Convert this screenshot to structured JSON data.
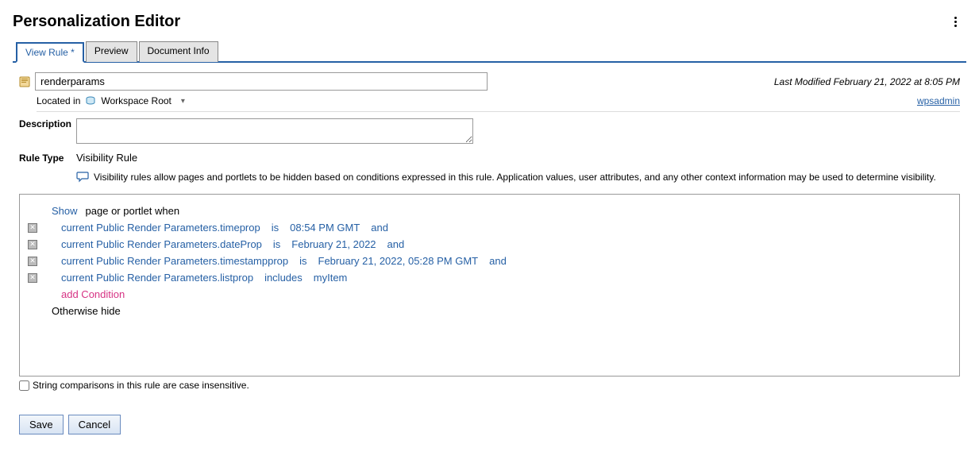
{
  "header": {
    "title": "Personalization Editor"
  },
  "tabs": [
    {
      "label": "View Rule *",
      "active": true
    },
    {
      "label": "Preview",
      "active": false
    },
    {
      "label": "Document Info",
      "active": false
    }
  ],
  "form": {
    "name_value": "renderparams",
    "last_modified": "Last Modified February 21, 2022 at 8:05 PM",
    "located_label": "Located in",
    "workspace_label": "Workspace Root",
    "user": "wpsadmin",
    "description_label": "Description",
    "description_value": "",
    "rule_type_label": "Rule Type",
    "rule_type_value": "Visibility Rule",
    "help_text": "Visibility rules allow pages and portlets to be hidden based on conditions expressed in this rule. Application values, user attributes, and any other context information may be used to determine visibility."
  },
  "rule": {
    "show": "Show",
    "when": "page or portlet when",
    "conditions": [
      {
        "attr": "current Public Render Parameters.timeprop",
        "op": "is",
        "val": "08:54 PM GMT",
        "join": "and"
      },
      {
        "attr": "current Public Render Parameters.dateProp",
        "op": "is",
        "val": "February 21, 2022",
        "join": "and"
      },
      {
        "attr": "current Public Render Parameters.timestampprop",
        "op": "is",
        "val": "February 21, 2022, 05:28 PM GMT",
        "join": "and"
      },
      {
        "attr": "current Public Render Parameters.listprop",
        "op": "includes",
        "val": "myItem",
        "join": ""
      }
    ],
    "add_label": "add Condition",
    "otherwise": "Otherwise hide"
  },
  "case_insensitive_label": "String comparisons in this rule are case insensitive.",
  "case_insensitive_checked": false,
  "buttons": {
    "save": "Save",
    "cancel": "Cancel"
  }
}
